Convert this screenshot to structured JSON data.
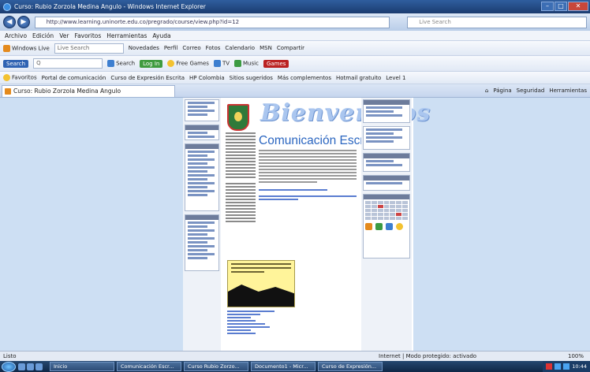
{
  "window": {
    "title": "Curso: Rubio Zorzola Medina Angulo - Windows Internet Explorer"
  },
  "address": {
    "url": "http://www.learning.uninorte.edu.co/pregrado/course/view.php?id=12",
    "search_placeholder": "Live Search"
  },
  "menu": {
    "items": [
      "Archivo",
      "Edición",
      "Ver",
      "Favoritos",
      "Herramientas",
      "Ayuda"
    ]
  },
  "toolbar1": {
    "brand": "Windows Live",
    "search": "Live Search",
    "links": [
      "Novedades",
      "Perfil",
      "Correo",
      "Fotos",
      "Calendario",
      "MSN",
      "Compartir"
    ]
  },
  "toolbar2": {
    "brand": "Search",
    "input": "Q",
    "search_label": "Search",
    "buttons": [
      "Log In",
      "Free Games",
      "TV",
      "Music",
      "Games"
    ]
  },
  "toolbar3": {
    "favorites": "Favoritos",
    "links": [
      "Portal de comunicación",
      "Curso de Expresión Escrita",
      "HP Colombia",
      "Sitios sugeridos",
      "Más complementos",
      "Hotmail gratuito",
      "Level 1"
    ]
  },
  "tab": {
    "label": "Curso: Rubio Zorzola Medina Angulo"
  },
  "commandbar": {
    "items": [
      "Página",
      "Seguridad",
      "Herramientas"
    ]
  },
  "page": {
    "banner": "Bienvenidos",
    "heading": "Comunicación Escrita"
  },
  "status": {
    "left": "Listo",
    "zone": "Internet | Modo protegido: activado",
    "zoom": "100%"
  },
  "taskbar": {
    "items": [
      "Inicio",
      "Comunicación Escr...",
      "Curso Rubio Zorzo...",
      "Documento1 - Micr...",
      "Curso de Expresión..."
    ],
    "clock": "10:44"
  },
  "colors": {
    "heading": "#2b66c0",
    "banner": "#aac6ef",
    "page_bg": "#cddff3"
  }
}
